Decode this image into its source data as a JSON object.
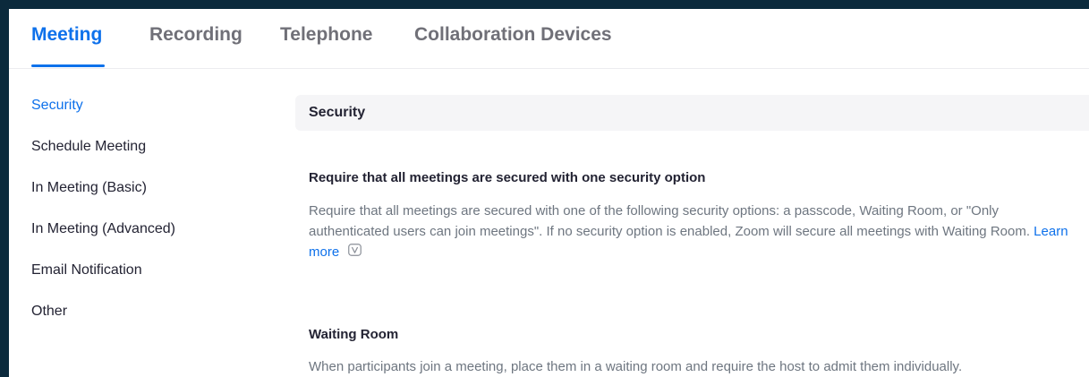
{
  "tabs": [
    {
      "label": "Meeting",
      "active": true
    },
    {
      "label": "Recording",
      "active": false
    },
    {
      "label": "Telephone",
      "active": false
    },
    {
      "label": "Collaboration Devices",
      "active": false
    }
  ],
  "sidebar": {
    "items": [
      {
        "label": "Security",
        "active": true
      },
      {
        "label": "Schedule Meeting",
        "active": false
      },
      {
        "label": "In Meeting (Basic)",
        "active": false
      },
      {
        "label": "In Meeting (Advanced)",
        "active": false
      },
      {
        "label": "Email Notification",
        "active": false
      },
      {
        "label": "Other",
        "active": false
      }
    ]
  },
  "main": {
    "section_title": "Security",
    "settings": [
      {
        "title": "Require that all meetings are secured with one security option",
        "description": "Require that all meetings are secured with one of the following security options: a passcode, Waiting Room, or \"Only authenticated users can join meetings\". If no security option is enabled, Zoom will secure all meetings with Waiting Room.",
        "link_label": "Learn more",
        "icon": "v-icon"
      },
      {
        "title": "Waiting Room",
        "description": "When participants join a meeting, place them in a waiting room and require the host to admit them individually."
      }
    ]
  },
  "colors": {
    "accent": "#0e71eb",
    "text": "#232333",
    "muted": "#6e7680",
    "outer_background": "#0b2a3c"
  }
}
